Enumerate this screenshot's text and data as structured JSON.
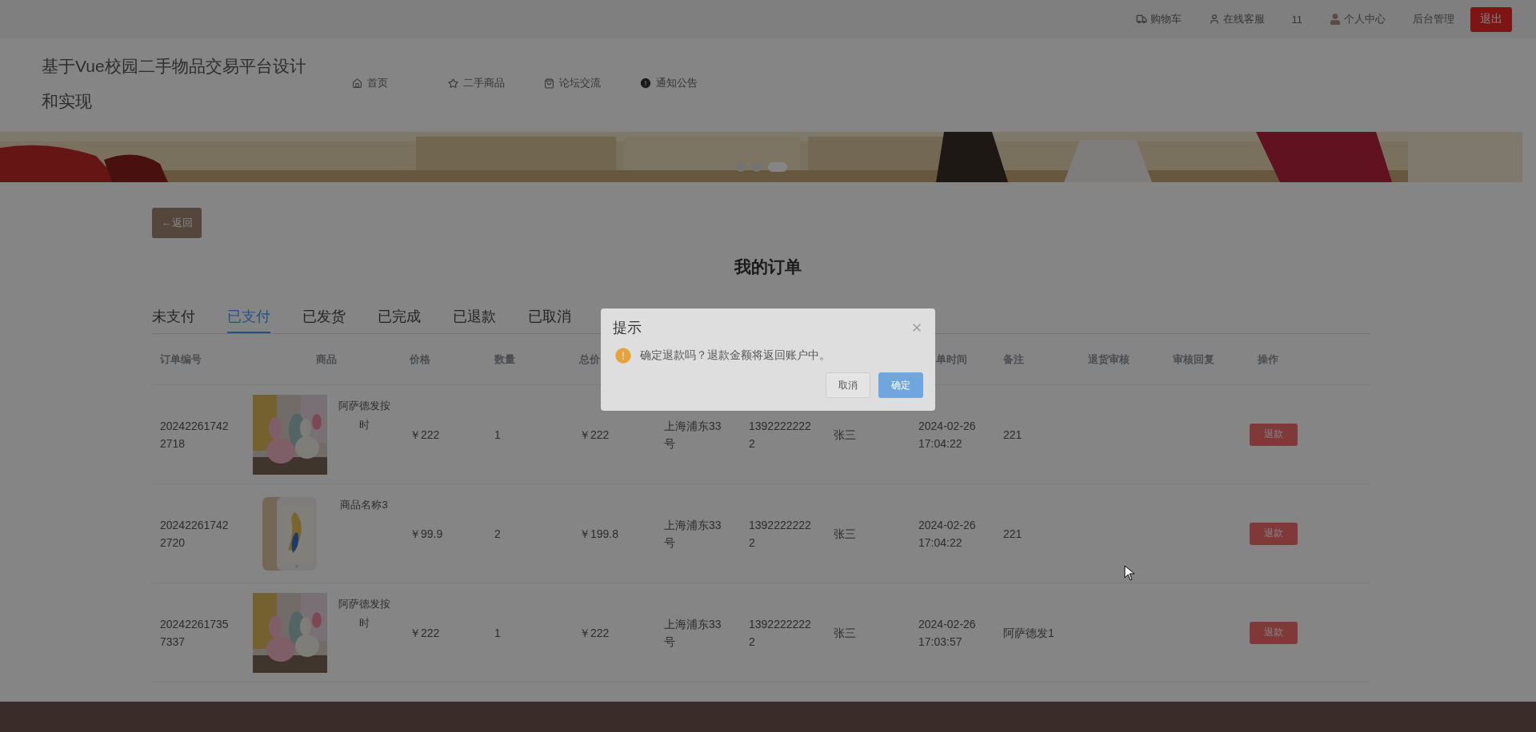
{
  "top_bar": {
    "links": [
      "购物车",
      "在线客服",
      "11",
      "个人中心",
      "后台管理"
    ],
    "logout": "退出"
  },
  "header": {
    "title": "基于Vue校园二手物品交易平台设计和实现",
    "nav": [
      "首页",
      "二手商品",
      "论坛交流",
      "通知公告"
    ]
  },
  "banner": {
    "kind": "picture",
    "dots": [
      {
        "selected": false
      },
      {
        "selected": false
      },
      {
        "selected": true
      }
    ]
  },
  "back_button": "←返回",
  "page_title": "我的订单",
  "tabs": [
    {
      "label": "未支付",
      "selected": false
    },
    {
      "label": "已支付",
      "selected": true
    },
    {
      "label": "已发货",
      "selected": false
    },
    {
      "label": "已完成",
      "selected": false
    },
    {
      "label": "已退款",
      "selected": false
    },
    {
      "label": "已取消",
      "selected": false
    }
  ],
  "table": {
    "columns_before_dialog": [
      "订单编号",
      "商品",
      "价格",
      "数量",
      "总价"
    ],
    "columns_after_dialog": [
      "单时间",
      "备注",
      "退货审核",
      "审核回复",
      "操作"
    ],
    "rows": [
      {
        "order_no": "202422617422718",
        "product": {
          "name": "阿萨德发按时",
          "kind": "plush"
        },
        "price": "￥222",
        "quantity": "1",
        "total": "￥222",
        "address": "上海浦东33号",
        "phone": "13922222222",
        "receiver": "张三",
        "time": "2024-02-26 17:04:22",
        "note": "221",
        "action": "退款"
      },
      {
        "order_no": "202422617422720",
        "product": {
          "name": "商品名称3",
          "kind": "phone"
        },
        "price": "￥99.9",
        "quantity": "2",
        "total": "￥199.8",
        "address": "上海浦东33号",
        "phone": "13922222222",
        "receiver": "张三",
        "time": "2024-02-26 17:04:22",
        "note": "221",
        "action": "退款"
      },
      {
        "order_no": "202422617357337",
        "product": {
          "name": "阿萨德发按时",
          "kind": "plush"
        },
        "price": "￥222",
        "quantity": "1",
        "total": "￥222",
        "address": "上海浦东33号",
        "phone": "13922222222",
        "receiver": "张三",
        "time": "2024-02-26 17:03:57",
        "note": "阿萨德发1",
        "action": "退款"
      }
    ]
  },
  "dialog": {
    "title": "提示",
    "message": "确定退款吗？退款金额将返回账户中。",
    "buttons": [
      {
        "label": "取消",
        "kind": "default"
      },
      {
        "label": "确定",
        "kind": "primary"
      }
    ]
  }
}
